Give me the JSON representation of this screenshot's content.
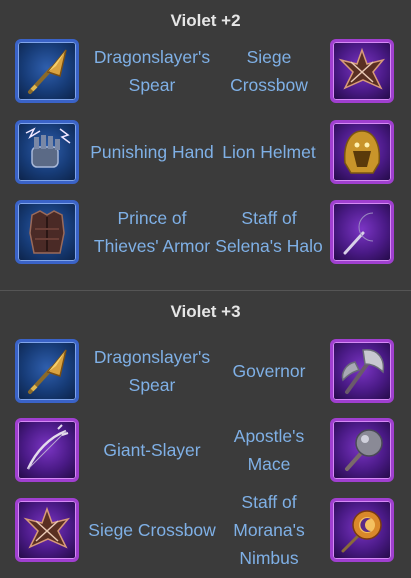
{
  "sections": [
    {
      "title": "Violet +2",
      "rows": [
        {
          "left": {
            "name": "Dragonslayer's Spear",
            "icon": "spear-icon",
            "frame": "blue"
          },
          "right": {
            "name": "Siege Crossbow",
            "icon": "crossbow-icon",
            "frame": "purple"
          }
        },
        {
          "left": {
            "name": "Punishing Hand",
            "icon": "gauntlet-icon",
            "frame": "blue"
          },
          "right": {
            "name": "Lion Helmet",
            "icon": "lion-helmet-icon",
            "frame": "purple"
          }
        },
        {
          "left": {
            "name": "Prince of Thieves' Armor",
            "icon": "armor-icon",
            "frame": "blue"
          },
          "right": {
            "name": "Staff of Selena's Halo",
            "icon": "crescent-staff-icon",
            "frame": "purple"
          }
        }
      ]
    },
    {
      "title": "Violet +3",
      "rows": [
        {
          "left": {
            "name": "Dragonslayer's Spear",
            "icon": "spear-icon",
            "frame": "blue"
          },
          "right": {
            "name": "Governor",
            "icon": "axe-icon",
            "frame": "purple"
          }
        },
        {
          "left": {
            "name": "Giant-Slayer",
            "icon": "bow-icon",
            "frame": "purple"
          },
          "right": {
            "name": "Apostle's Mace",
            "icon": "mace-icon",
            "frame": "purple"
          }
        },
        {
          "left": {
            "name": "Siege Crossbow",
            "icon": "crossbow-icon",
            "frame": "purple"
          },
          "right": {
            "name": "Staff of Morana's Nimbus",
            "icon": "sun-staff-icon",
            "frame": "purple"
          }
        }
      ]
    }
  ]
}
